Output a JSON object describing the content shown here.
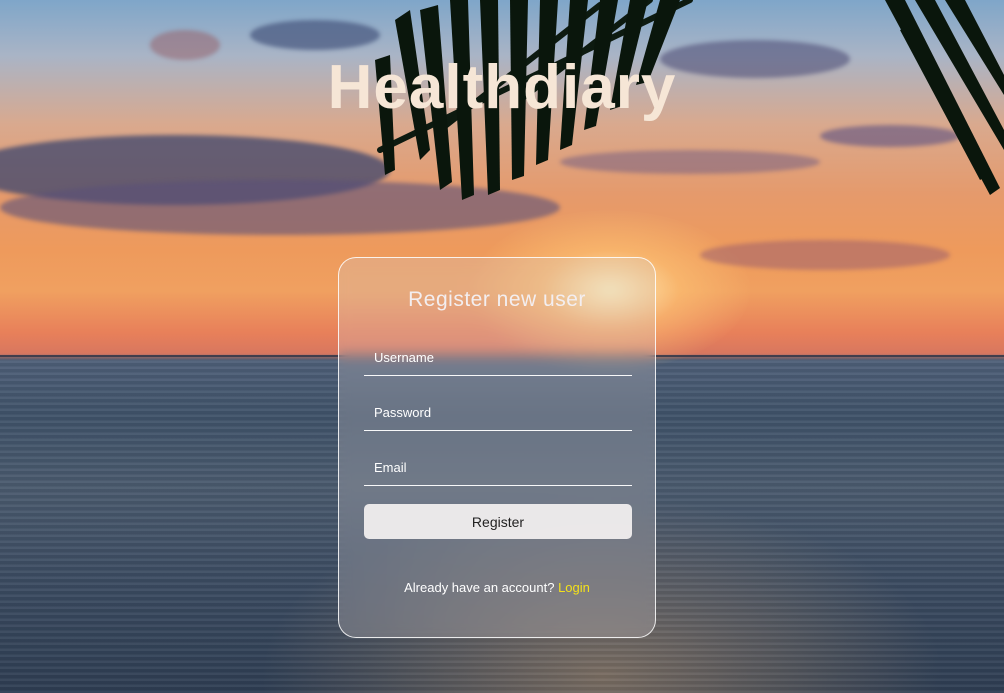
{
  "app": {
    "title": "Healthdiary"
  },
  "form": {
    "title": "Register new user",
    "username_placeholder": "Username",
    "password_placeholder": "Password",
    "email_placeholder": "Email",
    "register_label": "Register",
    "login_prompt": "Already have an account?",
    "login_link": "Login"
  },
  "colors": {
    "title_text": "#f6e6d6",
    "link_accent": "#f4e21a",
    "button_bg": "#f5f2f2"
  },
  "icons": {
    "background": "sunset-beach-background"
  }
}
